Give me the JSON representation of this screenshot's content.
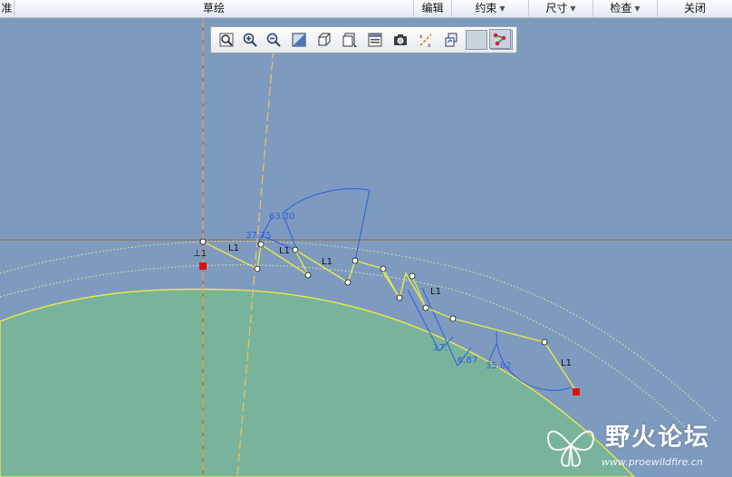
{
  "menu": {
    "items": [
      {
        "label": "准",
        "dropdown": false
      },
      {
        "label": "草绘",
        "dropdown": false
      },
      {
        "label": "编辑",
        "dropdown": false
      },
      {
        "label": "约束",
        "dropdown": true
      },
      {
        "label": "尺寸",
        "dropdown": true
      },
      {
        "label": "检查",
        "dropdown": true
      },
      {
        "label": "关闭",
        "dropdown": false
      }
    ]
  },
  "toolbar": {
    "buttons": [
      {
        "icon": "zoom-fit-icon",
        "active": false
      },
      {
        "icon": "zoom-in-icon",
        "active": false
      },
      {
        "icon": "zoom-out-icon",
        "active": false
      },
      {
        "icon": "view-refit-icon",
        "active": false
      },
      {
        "icon": "display-style-icon",
        "active": false
      },
      {
        "icon": "saved-views-icon",
        "active": false
      },
      {
        "icon": "view-manager-icon",
        "active": false
      },
      {
        "icon": "camera-icon",
        "active": false
      },
      {
        "icon": "datum-display-icon",
        "active": false
      },
      {
        "icon": "annotation-display-icon",
        "active": false
      },
      {
        "icon": "dimension-display-icon",
        "active": false
      },
      {
        "icon": "constraint-display-icon",
        "active": true
      },
      {
        "icon": "vertex-display-icon",
        "active": true
      }
    ]
  },
  "sketch": {
    "dimensions": [
      "63.30",
      "37.75",
      "17.",
      "6.87",
      "35.82"
    ],
    "constraint_label": "L1",
    "perpendicular_label": "⊥1"
  },
  "colors": {
    "background": "#7e9bbf",
    "surface_fill": "#79b39b",
    "sketch_line": "#e8e84a",
    "dimension": "#2f5fe0",
    "reference_line": "#9a6a2a",
    "centerline": "#e8a23c",
    "endpoint": "#e01010"
  },
  "watermark": {
    "title": "野火论坛",
    "url": "www.proewildfire.cn"
  }
}
